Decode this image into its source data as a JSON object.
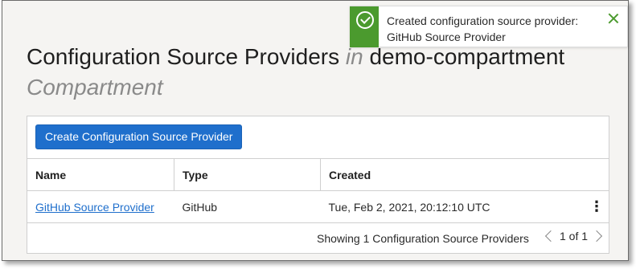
{
  "page": {
    "title_main": "Configuration Source Providers",
    "title_in": "in",
    "title_compartment": "demo-compartment",
    "title_suffix": "Compartment"
  },
  "toolbar": {
    "create_label": "Create Configuration Source Provider"
  },
  "table": {
    "headers": [
      "Name",
      "Type",
      "Created"
    ],
    "rows": [
      {
        "name": "GitHub Source Provider",
        "type": "GitHub",
        "created": "Tue, Feb 2, 2021, 20:12:10 UTC"
      }
    ]
  },
  "footer": {
    "showing": "Showing 1 Configuration Source Providers",
    "page_info": "1 of 1"
  },
  "toast": {
    "line1": "Created configuration source provider:",
    "line2": "GitHub Source Provider"
  },
  "colors": {
    "accent": "#1f6fcc",
    "success": "#4b9a2e"
  },
  "icons": {
    "toast": "check-circle-icon",
    "close": "close-icon",
    "row_menu": "kebab-menu-icon"
  }
}
